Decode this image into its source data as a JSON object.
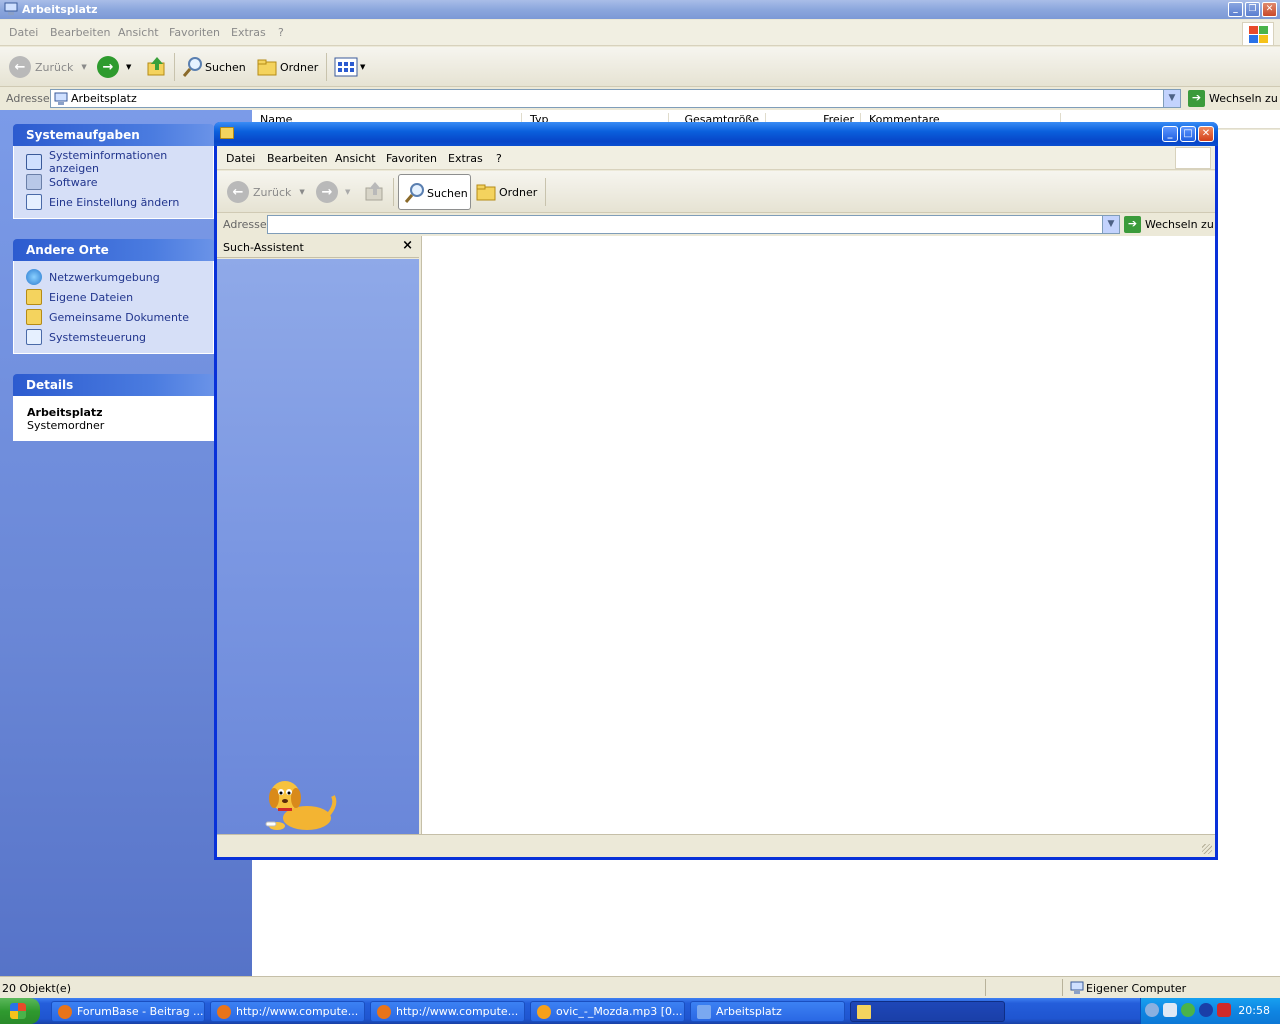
{
  "back_window": {
    "title": "Arbeitsplatz",
    "menu": [
      "Datei",
      "Bearbeiten",
      "Ansicht",
      "Favoriten",
      "Extras",
      "?"
    ],
    "toolbar": {
      "back": "Zurück",
      "search": "Suchen",
      "folders": "Ordner"
    },
    "address": {
      "label": "Adresse",
      "value": "Arbeitsplatz",
      "go": "Wechseln zu"
    },
    "panels": {
      "system_tasks": {
        "title": "Systemaufgaben",
        "items": [
          "Systeminformationen anzeigen",
          "Software",
          "Eine Einstellung ändern"
        ]
      },
      "other_places": {
        "title": "Andere Orte",
        "items": [
          "Netzwerkumgebung",
          "Eigene Dateien",
          "Gemeinsame Dokumente",
          "Systemsteuerung"
        ]
      },
      "details": {
        "title": "Details",
        "name": "Arbeitsplatz",
        "type": "Systemordner"
      }
    },
    "columns": [
      "Name",
      "Typ",
      "Gesamtgröße",
      "Freier Speicher",
      "Kommentare"
    ],
    "status": {
      "objects": "20 Objekt(e)",
      "location": "Eigener Computer"
    }
  },
  "front_window": {
    "menu": [
      "Datei",
      "Bearbeiten",
      "Ansicht",
      "Favoriten",
      "Extras",
      "?"
    ],
    "toolbar": {
      "back": "Zurück",
      "search": "Suchen",
      "folders": "Ordner"
    },
    "address": {
      "label": "Adresse",
      "value": "",
      "go": "Wechseln zu"
    },
    "search_pane": {
      "title": "Such-Assistent",
      "close": "×"
    }
  },
  "taskbar": {
    "tasks": [
      {
        "label": "ForumBase - Beitrag ...",
        "color": "#e8741a"
      },
      {
        "label": "http://www.compute...",
        "color": "#e8741a"
      },
      {
        "label": "http://www.compute...",
        "color": "#e8741a"
      },
      {
        "label": "ovic_-_Mozda.mp3 [0...",
        "color": "#f5a01a"
      },
      {
        "label": "Arbeitsplatz",
        "color": "#7aa8f0"
      }
    ],
    "clock": "20:58"
  }
}
